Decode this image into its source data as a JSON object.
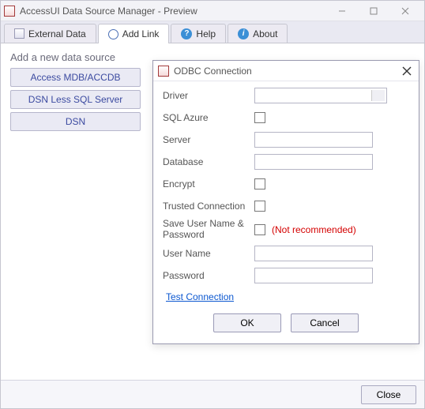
{
  "window": {
    "title": "AccessUI Data Source Manager - Preview"
  },
  "tabs": {
    "external": "External Data",
    "addlink": "Add Link",
    "help": "Help",
    "about": "About"
  },
  "sidebar": {
    "heading": "Add a new data source",
    "buttons": {
      "access": "Access MDB/ACCDB",
      "dsnless": "DSN Less SQL Server",
      "dsn": "DSN"
    }
  },
  "dialog": {
    "title": "ODBC Connection",
    "labels": {
      "driver": "Driver",
      "sqlazure": "SQL Azure",
      "server": "Server",
      "database": "Database",
      "encrypt": "Encrypt",
      "trusted": "Trusted Connection",
      "saveuser": "Save User Name & Password",
      "notrecommended": "(Not recommended)",
      "username": "User Name",
      "password": "Password"
    },
    "values": {
      "driver": "",
      "server": "",
      "database": "",
      "username": "",
      "password": ""
    },
    "test_link": "Test Connection",
    "ok": "OK",
    "cancel": "Cancel"
  },
  "footer": {
    "close": "Close"
  },
  "icons": {
    "help_glyph": "?",
    "info_glyph": "i"
  }
}
